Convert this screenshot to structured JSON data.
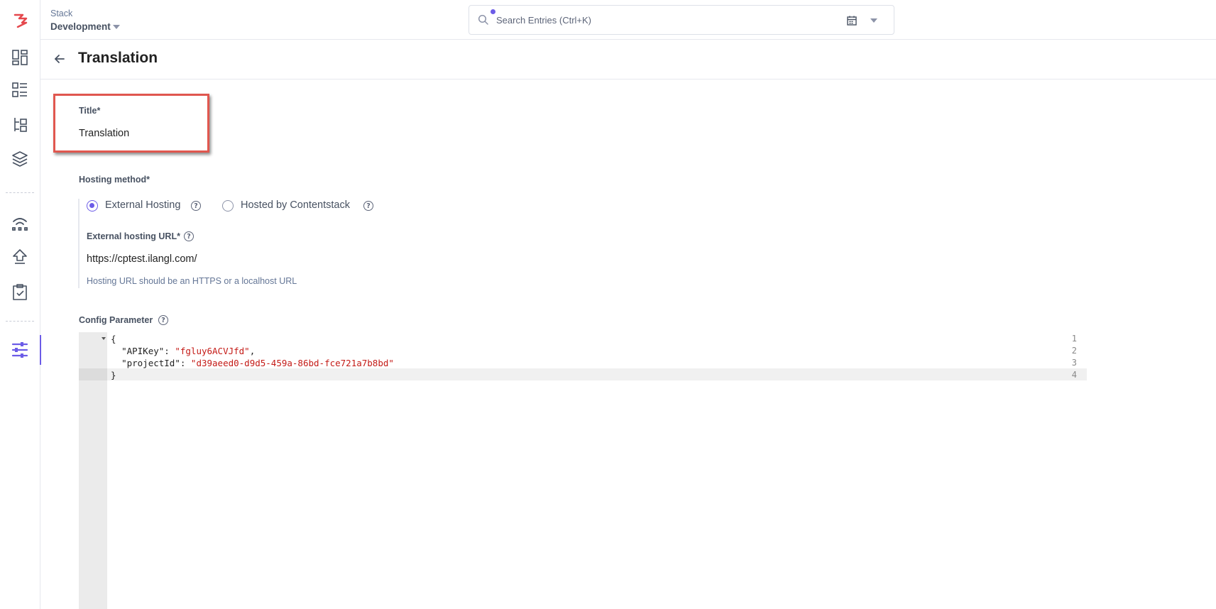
{
  "topbar": {
    "stack_label": "Stack",
    "stack_name": "Development",
    "search_placeholder": "Search Entries (Ctrl+K)"
  },
  "header": {
    "title": "Translation"
  },
  "form": {
    "title_label": "Title*",
    "title_value": "Translation",
    "hosting_label": "Hosting method*",
    "hosting_options": [
      {
        "label": "External Hosting",
        "selected": true
      },
      {
        "label": "Hosted by Contentstack",
        "selected": false
      }
    ],
    "url_label": "External hosting URL*",
    "url_value": "https://cptest.ilangl.com/",
    "url_hint": "Hosting URL should be an HTTPS or a localhost URL",
    "config_label": "Config Parameter"
  },
  "code": {
    "line_numbers": [
      "1",
      "2",
      "3",
      "4"
    ],
    "line1": "{",
    "key1": "\"APIKey\"",
    "val1": "\"fgluy6ACVJfd\"",
    "key2": "\"projectId\"",
    "val2": "\"d39aeed0-d9d5-459a-86bd-fce721a7b8bd\"",
    "line4": "}"
  },
  "colors": {
    "accent": "#6c5ce7",
    "highlight_box": "#e0574f",
    "string": "#c41a16"
  },
  "icons": {
    "rail": [
      "logo-icon",
      "dashboard-icon",
      "entries-icon",
      "content-models-icon",
      "assets-icon",
      "releases-icon",
      "publish-queue-icon",
      "tasks-icon",
      "settings-icon"
    ],
    "header": [
      "back-arrow-icon"
    ],
    "search": [
      "search-icon",
      "calendar-icon",
      "chevron-down-icon"
    ],
    "help": [
      "help-icon"
    ]
  }
}
